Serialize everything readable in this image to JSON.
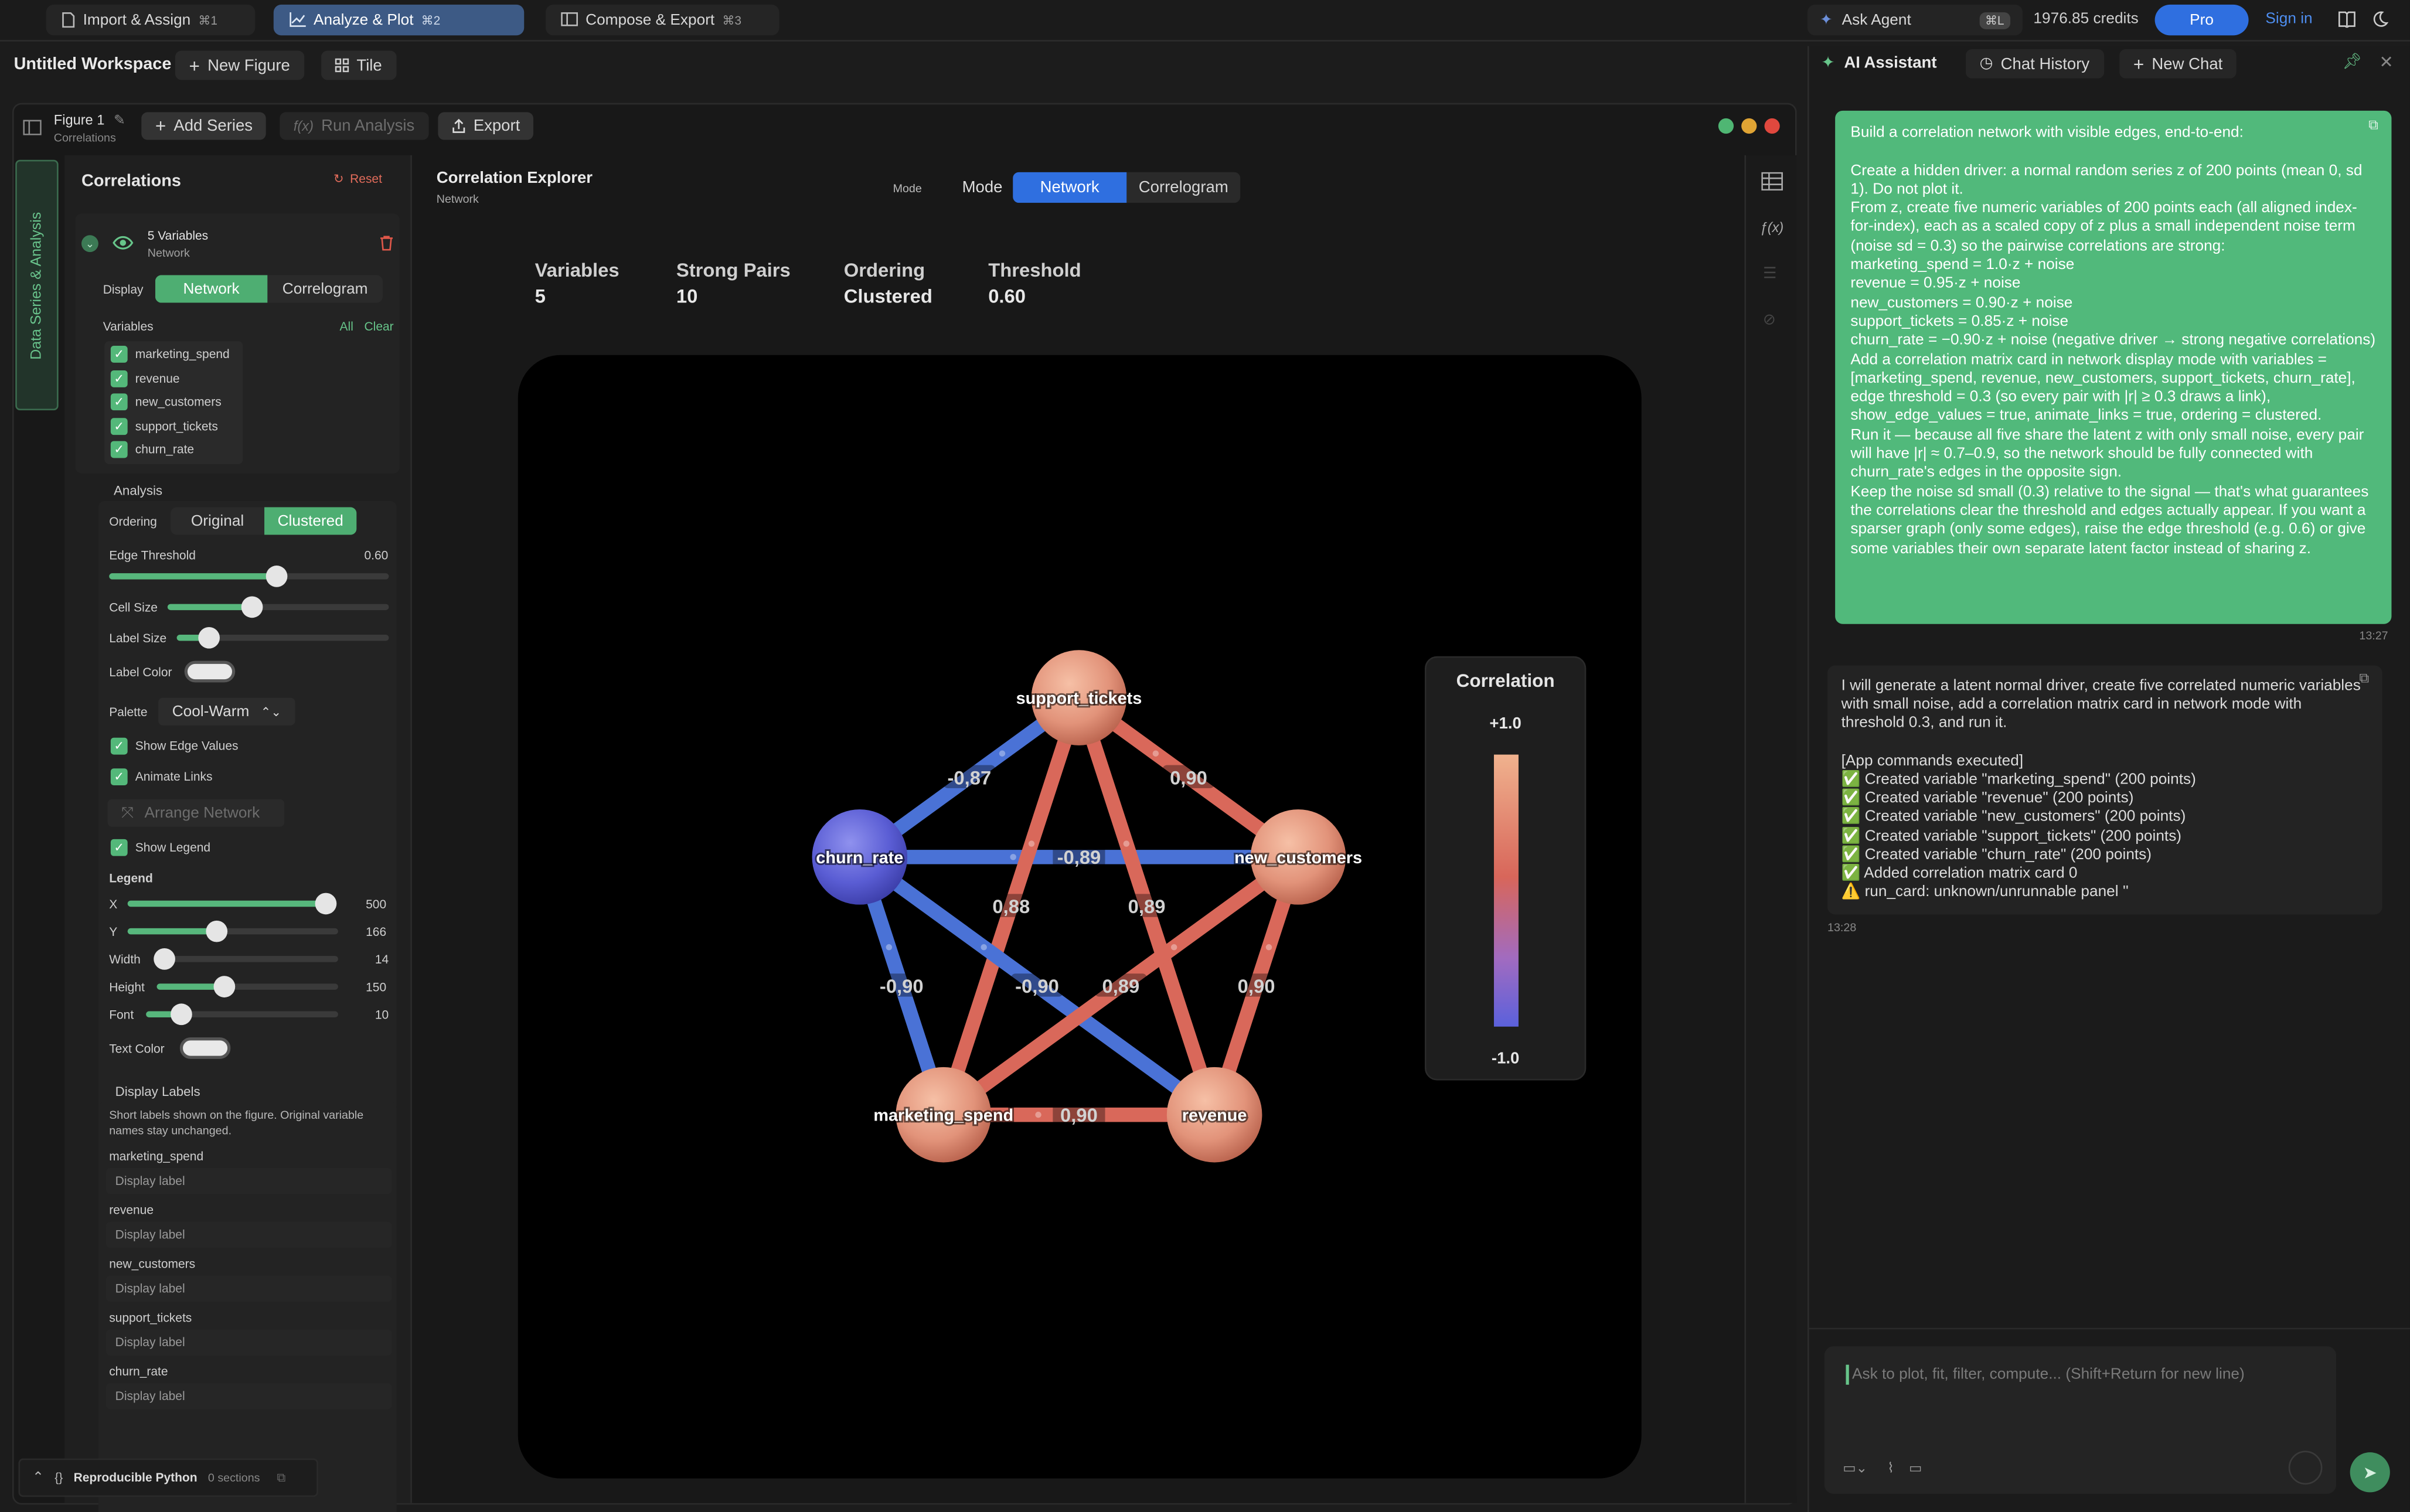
{
  "topbar": {
    "tabs": [
      {
        "label": "Import & Assign",
        "kbd": "⌘1"
      },
      {
        "label": "Analyze & Plot",
        "kbd": "⌘2"
      },
      {
        "label": "Compose & Export",
        "kbd": "⌘3"
      }
    ],
    "ask_agent": "Ask Agent",
    "kbd_l": "⌘L",
    "credits": "1976.85 credits",
    "pro": "Pro",
    "sign_in": "Sign in"
  },
  "workspace": {
    "title": "Untitled Workspace",
    "new_figure": "New Figure",
    "tile": "Tile"
  },
  "figure": {
    "name": "Figure 1",
    "subtitle": "Correlations",
    "add_series": "Add Series",
    "run_analysis": "Run Analysis",
    "export": "Export"
  },
  "sidebar_tab": "Data Series & Analysis",
  "left_panel": {
    "title": "Correlations",
    "reset": "Reset",
    "series_title": "5 Variables",
    "series_sub": "Network",
    "display_label": "Display",
    "display_options": [
      "Network",
      "Correlogram"
    ],
    "variables_label": "Variables",
    "all": "All",
    "clear": "Clear",
    "variables": [
      "marketing_spend",
      "revenue",
      "new_customers",
      "support_tickets",
      "churn_rate"
    ],
    "analysis_label": "Analysis",
    "ordering_label": "Ordering",
    "ordering_options": [
      "Original",
      "Clustered"
    ],
    "edge_threshold_label": "Edge Threshold",
    "edge_threshold_value": "0.60",
    "edge_threshold_level": 0.6,
    "cell_size_label": "Cell Size",
    "cell_size_level": 0.38,
    "label_size_label": "Label Size",
    "label_size_level": 0.15,
    "label_color_label": "Label Color",
    "palette_label": "Palette",
    "palette_value": "Cool-Warm",
    "show_edge_values": "Show Edge Values",
    "animate_links": "Animate Links",
    "arrange_network": "Arrange Network",
    "show_legend": "Show Legend",
    "legend_label": "Legend",
    "legend_sliders": [
      {
        "label": "X",
        "value": "500",
        "level": 1.0
      },
      {
        "label": "Y",
        "value": "166",
        "level": 0.42
      },
      {
        "label": "Width",
        "value": "14",
        "level": 0.0
      },
      {
        "label": "Height",
        "value": "150",
        "level": 0.37
      },
      {
        "label": "Font",
        "value": "10",
        "level": 0.18
      }
    ],
    "text_color_label": "Text Color",
    "display_labels_title": "Display Labels",
    "display_labels_desc": "Short labels shown on the figure. Original variable names stay unchanged.",
    "display_label_placeholder": "Display label",
    "reproducible_python": "Reproducible Python",
    "sections": "0 sections"
  },
  "canvas": {
    "title": "Correlation Explorer",
    "subtitle": "Network",
    "mode_small": "Mode",
    "mode_label": "Mode",
    "mode_options": [
      "Network",
      "Correlogram"
    ],
    "stats": [
      {
        "label": "Variables",
        "value": "5"
      },
      {
        "label": "Strong Pairs",
        "value": "10"
      },
      {
        "label": "Ordering",
        "value": "Clustered"
      },
      {
        "label": "Threshold",
        "value": "0.60"
      }
    ]
  },
  "chart_data": {
    "type": "network",
    "nodes": [
      "support_tickets",
      "churn_rate",
      "new_customers",
      "marketing_spend",
      "revenue"
    ],
    "edges": [
      {
        "source": "support_tickets",
        "target": "churn_rate",
        "value": -0.87,
        "label": "-0,87"
      },
      {
        "source": "support_tickets",
        "target": "new_customers",
        "value": 0.9,
        "label": "0,90"
      },
      {
        "source": "churn_rate",
        "target": "new_customers",
        "value": -0.89,
        "label": "-0,89"
      },
      {
        "source": "support_tickets",
        "target": "marketing_spend",
        "value": 0.88,
        "label": "0,88"
      },
      {
        "source": "support_tickets",
        "target": "revenue",
        "value": 0.89,
        "label": "0,89"
      },
      {
        "source": "churn_rate",
        "target": "marketing_spend",
        "value": -0.9,
        "label": "-0,90"
      },
      {
        "source": "churn_rate",
        "target": "revenue",
        "value": -0.9,
        "label": "-0,90"
      },
      {
        "source": "new_customers",
        "target": "marketing_spend",
        "value": 0.89,
        "label": "0,89"
      },
      {
        "source": "new_customers",
        "target": "revenue",
        "value": 0.9,
        "label": "0,90"
      },
      {
        "source": "marketing_spend",
        "target": "revenue",
        "value": 0.9,
        "label": "0,90"
      }
    ],
    "legend_title": "Correlation",
    "legend_max": "+1.0",
    "legend_min": "-1.0",
    "colors": {
      "positive": "#d9685a",
      "negative": "#4a72d6",
      "node": "#e6967a",
      "node_negative": "#5f63d8"
    }
  },
  "assistant": {
    "title": "AI Assistant",
    "chat_history": "Chat History",
    "new_chat": "New Chat",
    "user_message": "Build a correlation network with visible edges, end-to-end:\n\nCreate a hidden driver: a normal random series z of 200 points (mean 0, sd 1). Do not plot it.\nFrom z, create five numeric variables of 200 points each (all aligned index-for-index), each as a scaled copy of z plus a small independent noise term (noise sd = 0.3) so the pairwise correlations are strong:\nmarketing_spend = 1.0·z + noise\nrevenue = 0.95·z + noise\nnew_customers = 0.90·z + noise\nsupport_tickets = 0.85·z + noise\nchurn_rate = −0.90·z + noise (negative driver → strong negative correlations)\nAdd a correlation matrix card in network display mode with variables = [marketing_spend, revenue, new_customers, support_tickets, churn_rate], edge threshold = 0.3 (so every pair with |r| ≥ 0.3 draws a link), show_edge_values = true, animate_links = true, ordering = clustered.\nRun it — because all five share the latent z with only small noise, every pair will have |r| ≈ 0.7–0.9, so the network should be fully connected with churn_rate's edges in the opposite sign.\nKeep the noise sd small (0.3) relative to the signal — that's what guarantees the correlations clear the threshold and edges actually appear. If you want a sparser graph (only some edges), raise the edge threshold (e.g. 0.6) or give some variables their own separate latent factor instead of sharing z.",
    "user_time": "13:27",
    "ai_message": "I will generate a latent normal driver, create five correlated numeric variables with small noise, add a correlation matrix card in network mode with threshold 0.3, and run it.\n\n[App commands executed]\n✅ Created variable \"marketing_spend\" (200 points)\n✅ Created variable \"revenue\" (200 points)\n✅ Created variable \"new_customers\" (200 points)\n✅ Created variable \"support_tickets\" (200 points)\n✅ Created variable \"churn_rate\" (200 points)\n✅ Added correlation matrix card 0\n⚠️ run_card: unknown/unrunnable panel ''",
    "ai_time": "13:28",
    "input_placeholder": "Ask to plot, fit, filter, compute... (Shift+Return for new line)"
  }
}
